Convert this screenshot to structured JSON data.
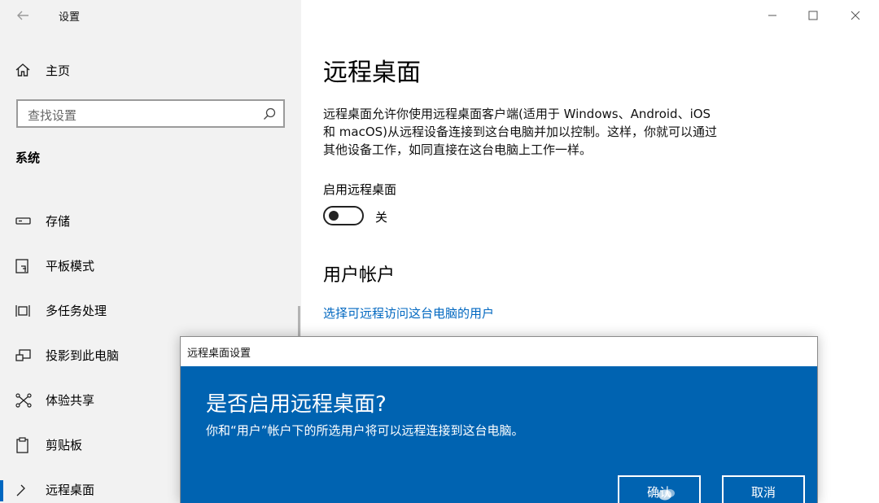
{
  "window": {
    "title": "设置",
    "controls": [
      "minimize-icon",
      "maximize-icon",
      "close-icon"
    ]
  },
  "sidebar": {
    "home_label": "主页",
    "search_placeholder": "查找设置",
    "section_title": "系统",
    "items": [
      {
        "label": "存储",
        "icon": "storage-icon"
      },
      {
        "label": "平板模式",
        "icon": "tablet-mode-icon"
      },
      {
        "label": "多任务处理",
        "icon": "multitasking-icon"
      },
      {
        "label": "投影到此电脑",
        "icon": "project-to-pc-icon"
      },
      {
        "label": "体验共享",
        "icon": "shared-experiences-icon"
      },
      {
        "label": "剪贴板",
        "icon": "clipboard-icon"
      },
      {
        "label": "远程桌面",
        "icon": "remote-desktop-icon",
        "selected": true
      }
    ]
  },
  "main": {
    "title": "远程桌面",
    "description_lines": [
      "远程桌面允许你使用远程桌面客户端(适用于 Windows、Android、iOS",
      "和 macOS)从远程设备连接到这台电脑并加以控制。这样，你就可以通过",
      "其他设备工作，如同直接在这台电脑上工作一样。"
    ],
    "toggle_label": "启用远程桌面",
    "toggle_state": "关",
    "toggle_on": false,
    "accounts_heading": "用户帐户",
    "accounts_link": "选择可远程访问这台电脑的用户"
  },
  "dialog": {
    "title": "远程桌面设置",
    "heading": "是否启用远程桌面?",
    "message": "你和“用户”帐户下的所选用户将可以远程连接到这台电脑。",
    "confirm_label": "确认",
    "cancel_label": "取消"
  },
  "colors": {
    "accent": "#0067c0",
    "dialog_blue": "#0063b1",
    "sidebar_bg": "#f2f2f2"
  }
}
